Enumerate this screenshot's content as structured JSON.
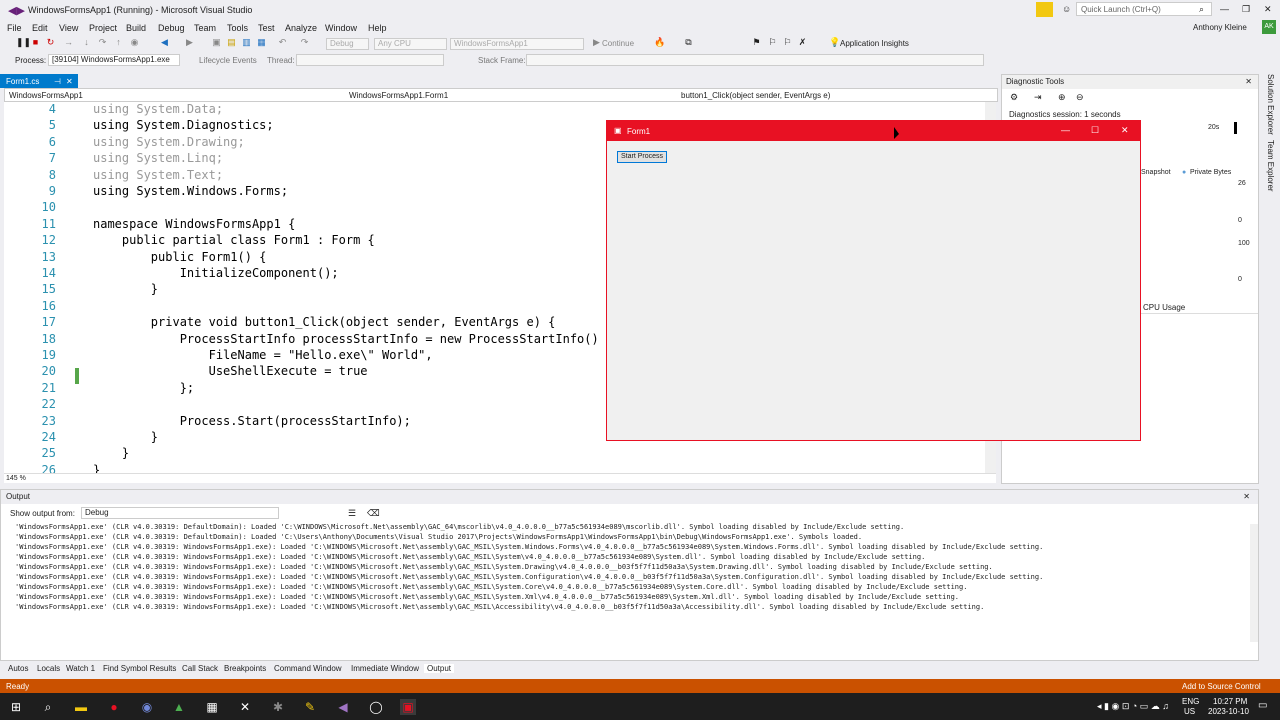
{
  "window": {
    "title": "WindowsFormsApp1 (Running) - Microsoft Visual Studio",
    "quick_launch_placeholder": "Quick Launch (Ctrl+Q)",
    "user_name": "Anthony Kleine",
    "user_initials": "AK"
  },
  "menu": [
    "File",
    "Edit",
    "View",
    "Project",
    "Build",
    "Debug",
    "Team",
    "Tools",
    "Test",
    "Analyze",
    "Window",
    "Help"
  ],
  "toolbar": {
    "config": "Debug",
    "platform": "Any CPU",
    "startup": "WindowsFormsApp1",
    "continue_label": "Continue",
    "insights_label": "Application Insights"
  },
  "process_bar": {
    "process_label": "Process:",
    "process_value": "[39104] WindowsFormsApp1.exe",
    "lifecycle_label": "Lifecycle Events",
    "thread_label": "Thread:",
    "stackframe_label": "Stack Frame:"
  },
  "editor": {
    "tab_label": "Form1.cs",
    "nav_project": "WindowsFormsApp1",
    "nav_class": "WindowsFormsApp1.Form1",
    "nav_member": "button1_Click(object sender, EventArgs e)",
    "zoom": "145 %",
    "lines": [
      {
        "n": "4",
        "t": "using System.Data;"
      },
      {
        "n": "5",
        "t": "using System.Diagnostics;"
      },
      {
        "n": "6",
        "t": "using System.Drawing;"
      },
      {
        "n": "7",
        "t": "using System.Linq;"
      },
      {
        "n": "8",
        "t": "using System.Text;"
      },
      {
        "n": "9",
        "t": "using System.Windows.Forms;"
      },
      {
        "n": "10",
        "t": ""
      },
      {
        "n": "11",
        "t": "namespace WindowsFormsApp1 {"
      },
      {
        "n": "12",
        "t": "    public partial class Form1 : Form {"
      },
      {
        "n": "13",
        "t": "        public Form1() {"
      },
      {
        "n": "14",
        "t": "            InitializeComponent();"
      },
      {
        "n": "15",
        "t": "        }"
      },
      {
        "n": "16",
        "t": ""
      },
      {
        "n": "17",
        "t": "        private void button1_Click(object sender, EventArgs e) {"
      },
      {
        "n": "18",
        "t": "            ProcessStartInfo processStartInfo = new ProcessStartInfo() {"
      },
      {
        "n": "19",
        "t": "                FileName = \"Hello.exe\\\" World\","
      },
      {
        "n": "20",
        "t": "                UseShellExecute = true"
      },
      {
        "n": "21",
        "t": "            };"
      },
      {
        "n": "22",
        "t": ""
      },
      {
        "n": "23",
        "t": "            Process.Start(processStartInfo);"
      },
      {
        "n": "24",
        "t": "        }"
      },
      {
        "n": "25",
        "t": "    }"
      },
      {
        "n": "26",
        "t": "}"
      }
    ]
  },
  "diagnostics": {
    "title": "Diagnostic Tools",
    "session": "Diagnostics session: 1 seconds",
    "time_label": "20s",
    "snapshot_label": "Snapshot",
    "private_bytes_label": "Private Bytes",
    "mem_max": "26",
    "mem_min": "0",
    "cpu_max": "100",
    "cpu_min": "0",
    "cpu_label": "CPU Usage",
    "side_tabs": [
      "Solution Explorer",
      "Team Explorer"
    ]
  },
  "form1": {
    "title": "Form1",
    "button_label": "Start Process"
  },
  "output": {
    "title": "Output",
    "show_from_label": "Show output from:",
    "show_from_value": "Debug",
    "lines": [
      "'WindowsFormsApp1.exe' (CLR v4.0.30319: DefaultDomain): Loaded 'C:\\WINDOWS\\Microsoft.Net\\assembly\\GAC_64\\mscorlib\\v4.0_4.0.0.0__b77a5c561934e089\\mscorlib.dll'. Symbol loading disabled by Include/Exclude setting.",
      "'WindowsFormsApp1.exe' (CLR v4.0.30319: DefaultDomain): Loaded 'C:\\Users\\Anthony\\Documents\\Visual Studio 2017\\Projects\\WindowsFormsApp1\\WindowsFormsApp1\\bin\\Debug\\WindowsFormsApp1.exe'. Symbols loaded.",
      "'WindowsFormsApp1.exe' (CLR v4.0.30319: WindowsFormsApp1.exe): Loaded 'C:\\WINDOWS\\Microsoft.Net\\assembly\\GAC_MSIL\\System.Windows.Forms\\v4.0_4.0.0.0__b77a5c561934e089\\System.Windows.Forms.dll'. Symbol loading disabled by Include/Exclude setting.",
      "'WindowsFormsApp1.exe' (CLR v4.0.30319: WindowsFormsApp1.exe): Loaded 'C:\\WINDOWS\\Microsoft.Net\\assembly\\GAC_MSIL\\System\\v4.0_4.0.0.0__b77a5c561934e089\\System.dll'. Symbol loading disabled by Include/Exclude setting.",
      "'WindowsFormsApp1.exe' (CLR v4.0.30319: WindowsFormsApp1.exe): Loaded 'C:\\WINDOWS\\Microsoft.Net\\assembly\\GAC_MSIL\\System.Drawing\\v4.0_4.0.0.0__b03f5f7f11d50a3a\\System.Drawing.dll'. Symbol loading disabled by Include/Exclude setting.",
      "'WindowsFormsApp1.exe' (CLR v4.0.30319: WindowsFormsApp1.exe): Loaded 'C:\\WINDOWS\\Microsoft.Net\\assembly\\GAC_MSIL\\System.Configuration\\v4.0_4.0.0.0__b03f5f7f11d50a3a\\System.Configuration.dll'. Symbol loading disabled by Include/Exclude setting.",
      "'WindowsFormsApp1.exe' (CLR v4.0.30319: WindowsFormsApp1.exe): Loaded 'C:\\WINDOWS\\Microsoft.Net\\assembly\\GAC_MSIL\\System.Core\\v4.0_4.0.0.0__b77a5c561934e089\\System.Core.dll'. Symbol loading disabled by Include/Exclude setting.",
      "'WindowsFormsApp1.exe' (CLR v4.0.30319: WindowsFormsApp1.exe): Loaded 'C:\\WINDOWS\\Microsoft.Net\\assembly\\GAC_MSIL\\System.Xml\\v4.0_4.0.0.0__b77a5c561934e089\\System.Xml.dll'. Symbol loading disabled by Include/Exclude setting.",
      "'WindowsFormsApp1.exe' (CLR v4.0.30319: WindowsFormsApp1.exe): Loaded 'C:\\WINDOWS\\Microsoft.Net\\assembly\\GAC_MSIL\\Accessibility\\v4.0_4.0.0.0__b03f5f7f11d50a3a\\Accessibility.dll'. Symbol loading disabled by Include/Exclude setting."
    ]
  },
  "bottom_tabs": [
    "Autos",
    "Locals",
    "Watch 1",
    "Find Symbol Results",
    "Call Stack",
    "Breakpoints",
    "Command Window",
    "Immediate Window",
    "Output"
  ],
  "status": {
    "text": "Ready",
    "source_control": "Add to Source Control"
  },
  "taskbar": {
    "lang": "ENG",
    "region": "US",
    "time": "10:27 PM",
    "date": "2023-10-10"
  },
  "colors": {
    "accent": "#007acc",
    "status_bar": "#ca5100",
    "form_title": "#e81123"
  }
}
